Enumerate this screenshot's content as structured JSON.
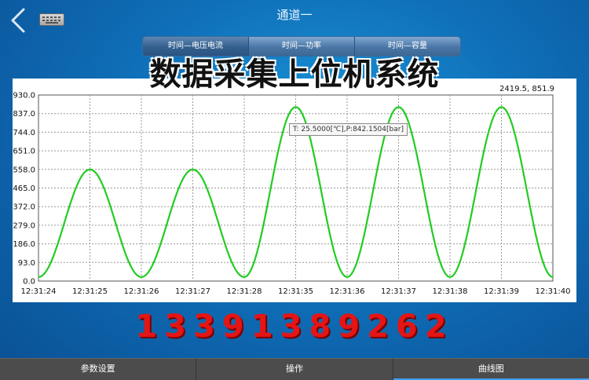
{
  "header": {
    "title": "通道一"
  },
  "tabs": [
    {
      "label": "时间—电压电流",
      "active": true
    },
    {
      "label": "时间—功率",
      "active": false
    },
    {
      "label": "时间—容量",
      "active": false
    }
  ],
  "watermark": "数据采集上位机系统",
  "phone": "13391389262",
  "readout": "2419.5, 851.9",
  "tooltip": "T: 25.5000[℃],P:842.1504[bar]",
  "colors": {
    "line": "#22cc22",
    "background": "#1479c4",
    "phone": "#e41515"
  },
  "chart_data": {
    "type": "line",
    "ylim": [
      0,
      930
    ],
    "yticks": [
      "930.0",
      "837.0",
      "744.0",
      "651.0",
      "558.0",
      "465.0",
      "372.0",
      "279.0",
      "186.0",
      "93.0",
      "0.0"
    ],
    "xticks": [
      "12:31:24",
      "12:31:25",
      "12:31:26",
      "12:31:27",
      "12:31:28",
      "12:31:35",
      "12:31:36",
      "12:31:37",
      "12:31:38",
      "12:31:39",
      "12:31:40"
    ],
    "grid": true,
    "series": [
      {
        "color": "#22cc22",
        "points": [
          [
            0,
            20
          ],
          [
            1,
            558
          ],
          [
            2,
            20
          ],
          [
            3,
            558
          ],
          [
            4,
            20
          ],
          [
            5,
            870
          ],
          [
            6,
            20
          ],
          [
            7,
            870
          ],
          [
            8,
            20
          ],
          [
            9,
            870
          ],
          [
            10,
            20
          ]
        ]
      }
    ]
  },
  "bottom_nav": [
    {
      "label": "参数设置",
      "active": false
    },
    {
      "label": "操作",
      "active": false
    },
    {
      "label": "曲线图",
      "active": true
    }
  ]
}
